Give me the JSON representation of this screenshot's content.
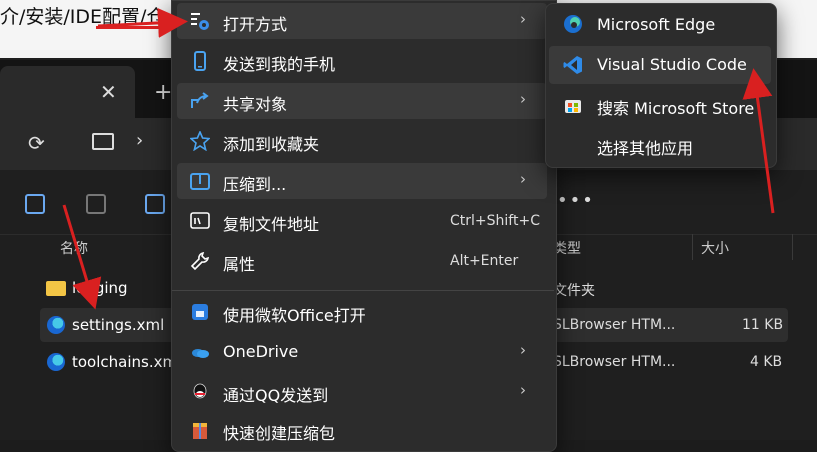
{
  "background_page": {
    "path_text": "介/安装/IDE配置/仓"
  },
  "explorer": {
    "tab": {
      "close_label": "✕",
      "add_label": "+"
    },
    "address": {
      "chevron": "›"
    },
    "columns": {
      "name": "名称",
      "type": "类型",
      "size": "大小"
    },
    "files": [
      {
        "name": "logging",
        "type": "文件夹",
        "size": "",
        "icon": "folder-icon"
      },
      {
        "name": "settings.xml",
        "type": "SLBrowser HTM...",
        "size": "11 KB",
        "icon": "edge-file-icon"
      },
      {
        "name": "toolchains.xml",
        "type": "SLBrowser HTM...",
        "size": "4 KB",
        "icon": "edge-file-icon"
      }
    ]
  },
  "context_menu": {
    "items": [
      {
        "label": "打开方式",
        "shortcut": "",
        "submenu": true,
        "icon": "open-with-icon"
      },
      {
        "label": "发送到我的手机",
        "shortcut": "",
        "submenu": false,
        "icon": "phone-icon"
      },
      {
        "label": "共享对象",
        "shortcut": "",
        "submenu": true,
        "icon": "share-icon"
      },
      {
        "label": "添加到收藏夹",
        "shortcut": "",
        "submenu": false,
        "icon": "star-icon"
      },
      {
        "label": "压缩到...",
        "shortcut": "",
        "submenu": true,
        "icon": "zip-folder-icon"
      },
      {
        "label": "复制文件地址",
        "shortcut": "Ctrl+Shift+C",
        "submenu": false,
        "icon": "copy-path-icon"
      },
      {
        "label": "属性",
        "shortcut": "Alt+Enter",
        "submenu": false,
        "icon": "wrench-icon"
      },
      {
        "label": "使用微软Office打开",
        "shortcut": "",
        "submenu": false,
        "icon": "office-icon"
      },
      {
        "label": "OneDrive",
        "shortcut": "",
        "submenu": true,
        "icon": "onedrive-icon"
      },
      {
        "label": "通过QQ发送到",
        "shortcut": "",
        "submenu": true,
        "icon": "qq-icon"
      },
      {
        "label": "快速创建压缩包",
        "shortcut": "",
        "submenu": false,
        "icon": "archive-icon"
      }
    ],
    "arrow_glyph": "›"
  },
  "submenu": {
    "items": [
      {
        "label": "Microsoft Edge",
        "icon": "edge-icon"
      },
      {
        "label": "Visual Studio Code",
        "icon": "vscode-icon"
      },
      {
        "label": "搜索 Microsoft Store",
        "icon": "store-icon"
      },
      {
        "label": "选择其他应用",
        "icon": ""
      }
    ]
  },
  "toolbar": {
    "more_label": "•••"
  },
  "colors": {
    "accent_blue": "#4aa3f0",
    "annotation_red": "#d92020",
    "menu_bg": "#2c2c2c"
  }
}
